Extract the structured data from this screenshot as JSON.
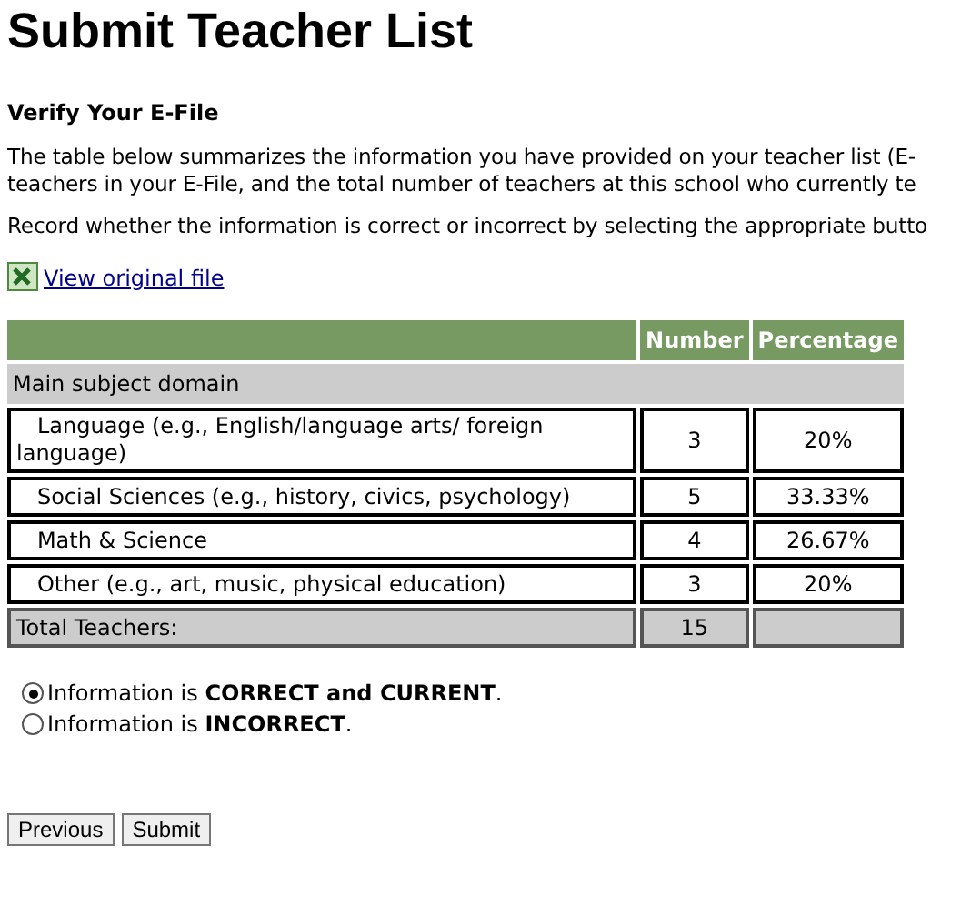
{
  "title": "Submit Teacher List",
  "section_heading": "Verify Your E-File",
  "intro_lines": [
    "The table below summarizes the information you have provided on your teacher list (E-",
    "teachers in your E-File, and the total number of teachers at this school who currently te"
  ],
  "instruction": "Record whether the information is correct or incorrect by selecting the appropriate butto",
  "file_link": "View original file",
  "table": {
    "columns": [
      "Number",
      "Percentage"
    ],
    "group_label": "Main subject domain",
    "rows": [
      {
        "label": "Language (e.g., English/language arts/ foreign language)",
        "number": "3",
        "percentage": "20%"
      },
      {
        "label": "Social Sciences (e.g., history, civics, psychology)",
        "number": "5",
        "percentage": "33.33%"
      },
      {
        "label": "Math & Science",
        "number": "4",
        "percentage": "26.67%"
      },
      {
        "label": "Other (e.g., art, music, physical education)",
        "number": "3",
        "percentage": "20%"
      }
    ],
    "total": {
      "label": "Total Teachers:",
      "number": "15"
    }
  },
  "options": [
    {
      "label": "Information is **CORRECT and CURRENT**.",
      "selected": true
    },
    {
      "label": "Information is **INCORRECT**.",
      "selected": false
    }
  ],
  "buttons": [
    "Previous",
    "Submit"
  ]
}
